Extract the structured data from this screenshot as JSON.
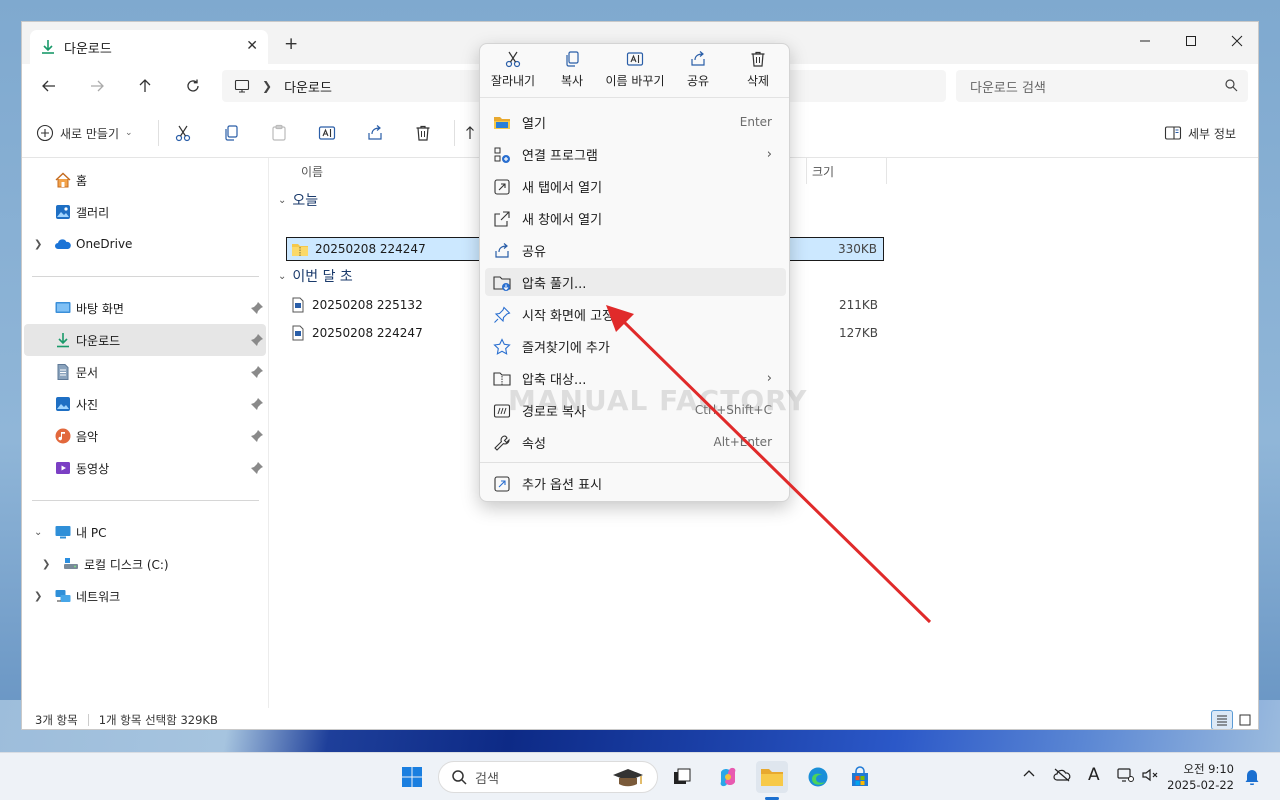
{
  "window": {
    "tab_title": "다운로드",
    "close_tab": "✕",
    "new_tab": "+",
    "minimize": "—",
    "maximize": "☐",
    "close": "✕"
  },
  "address": {
    "breadcrumb": "다운로드",
    "search_placeholder": "다운로드 검색"
  },
  "commandbar": {
    "new_label": "새로 만들기",
    "details_label": "세부 정보"
  },
  "sidebar": {
    "items": [
      {
        "label": "홈",
        "icon": "home-icon"
      },
      {
        "label": "갤러리",
        "icon": "gallery-icon"
      },
      {
        "label": "OneDrive",
        "icon": "onedrive-icon"
      },
      {
        "label": "바탕 화면",
        "icon": "desktop-icon"
      },
      {
        "label": "다운로드",
        "icon": "download-icon"
      },
      {
        "label": "문서",
        "icon": "documents-icon"
      },
      {
        "label": "사진",
        "icon": "pictures-icon"
      },
      {
        "label": "음악",
        "icon": "music-icon"
      },
      {
        "label": "동영상",
        "icon": "videos-icon"
      },
      {
        "label": "내 PC",
        "icon": "pc-icon"
      },
      {
        "label": "로컬 디스크 (C:)",
        "icon": "drive-icon"
      },
      {
        "label": "네트워크",
        "icon": "network-icon"
      }
    ]
  },
  "list": {
    "columns": {
      "name": "이름",
      "size": "크기"
    },
    "groups": [
      {
        "label": "오늘",
        "files": [
          {
            "name": "20250208 224247",
            "size": "330KB",
            "type": "zip"
          }
        ]
      },
      {
        "label": "이번 달 초",
        "files": [
          {
            "name": "20250208 225132",
            "size": "211KB",
            "type": "doc"
          },
          {
            "name": "20250208 224247",
            "size": "127KB",
            "type": "doc"
          }
        ]
      }
    ]
  },
  "status": {
    "count": "3개 항목",
    "selection": "1개 항목 선택함 329KB"
  },
  "context_menu": {
    "quick_actions": [
      {
        "label": "잘라내기",
        "icon": "cut-icon"
      },
      {
        "label": "복사",
        "icon": "copy-icon"
      },
      {
        "label": "이름 바꾸기",
        "icon": "rename-icon"
      },
      {
        "label": "공유",
        "icon": "share-icon"
      },
      {
        "label": "삭제",
        "icon": "delete-icon"
      }
    ],
    "items": [
      {
        "label": "열기",
        "shortcut": "Enter"
      },
      {
        "label": "연결 프로그램",
        "submenu": "›"
      },
      {
        "label": "새 탭에서 열기"
      },
      {
        "label": "새 창에서 열기"
      },
      {
        "label": "공유"
      },
      {
        "label": "압축 풀기..."
      },
      {
        "label": "시작 화면에 고정"
      },
      {
        "label": "즐겨찾기에 추가"
      },
      {
        "label": "압축 대상...",
        "submenu": "›"
      },
      {
        "label": "경로로 복사",
        "shortcut": "Ctrl+Shift+C"
      },
      {
        "label": "속성",
        "shortcut": "Alt+Enter"
      },
      {
        "label": "추가 옵션 표시"
      }
    ]
  },
  "watermark": "MANUAL FACTORY",
  "taskbar": {
    "search_label": "검색",
    "time": "오전 9:10",
    "date": "2025-02-22",
    "ime": "A"
  },
  "colors": {
    "accent": "#0067c0",
    "selection": "#cce8ff",
    "arrow": "#e02a2a"
  }
}
